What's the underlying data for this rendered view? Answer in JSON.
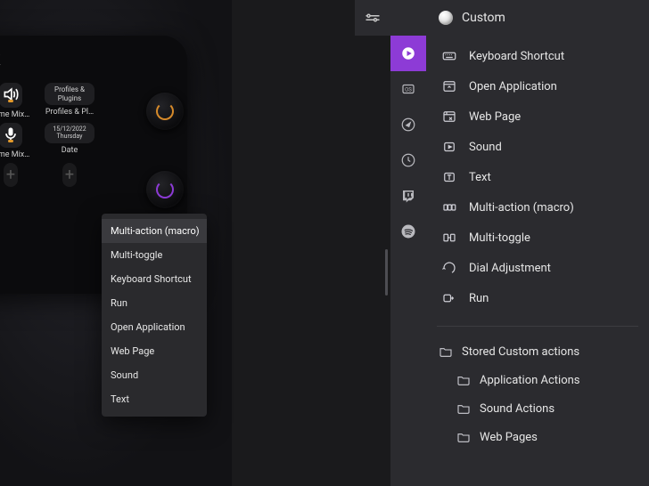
{
  "colors": {
    "accent_purple": "#8d3bd6",
    "accent_orange": "#d68a2a"
  },
  "device": {
    "title_letter": "k",
    "tiles": [
      {
        "label": "lume Mix…",
        "icon": "speaker"
      },
      {
        "label": "Profiles & Pl…",
        "text": "Profiles & Plugins"
      },
      {
        "label": "lume Mix…",
        "icon": "mic"
      },
      {
        "label": "Date",
        "text": "15/12/2022 Thursday"
      }
    ],
    "empty_tiles": 2
  },
  "context_menu": {
    "items": [
      "Multi-action (macro)",
      "Multi-toggle",
      "Keyboard Shortcut",
      "Run",
      "Open Application",
      "Web Page",
      "Sound",
      "Text"
    ],
    "hover_index": 0
  },
  "right_panel": {
    "header": "Custom",
    "vtabs": [
      {
        "name": "elgato",
        "selected": true
      },
      {
        "name": "obs",
        "selected": false
      },
      {
        "name": "compass",
        "selected": false
      },
      {
        "name": "clock-globe",
        "selected": false
      },
      {
        "name": "twitch",
        "selected": false
      },
      {
        "name": "spotify",
        "selected": false
      }
    ],
    "actions": [
      {
        "icon": "keyboard",
        "label": "Keyboard Shortcut"
      },
      {
        "icon": "open-app",
        "label": "Open Application"
      },
      {
        "icon": "web-page",
        "label": "Web Page"
      },
      {
        "icon": "sound",
        "label": "Sound"
      },
      {
        "icon": "text",
        "label": "Text"
      },
      {
        "icon": "multi-action",
        "label": "Multi-action (macro)"
      },
      {
        "icon": "multi-toggle",
        "label": "Multi-toggle"
      },
      {
        "icon": "dial",
        "label": "Dial Adjustment"
      },
      {
        "icon": "run",
        "label": "Run"
      }
    ],
    "stored": {
      "header": "Stored Custom actions",
      "children": [
        "Application Actions",
        "Sound Actions",
        "Web Pages"
      ]
    }
  }
}
